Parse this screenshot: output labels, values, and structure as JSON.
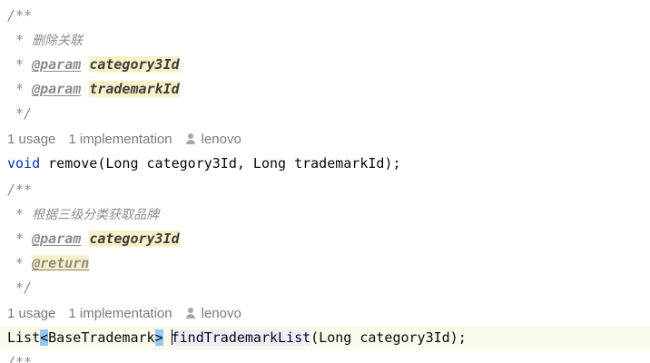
{
  "block1": {
    "open": "/**",
    "star": " * ",
    "desc": "删除关联",
    "param_tag": "@param",
    "param1": "category3Id",
    "param2": "trademarkId",
    "close": " */",
    "usages": "1 usage",
    "implementations": "1 implementation",
    "author": "lenovo",
    "signature": {
      "kw_void": "void",
      "rest": " remove(Long category3Id, Long trademarkId);"
    }
  },
  "block2": {
    "open": "/**",
    "star": " * ",
    "desc": "根据三级分类获取品牌",
    "param_tag": "@param",
    "param1": "category3Id",
    "return_tag": "@return",
    "close": " */",
    "usages": "1 usage",
    "implementations": "1 implementation",
    "author": "lenovo",
    "signature": {
      "list": "List",
      "lt": "<",
      "type": "BaseTrademark",
      "gt": ">",
      "space": " ",
      "method_first": "f",
      "method_rest": "indTrademarkList",
      "args": "(Long category3Id);"
    }
  },
  "next_line_fragment": "/**",
  "icons": {
    "author": "user-icon"
  },
  "colors": {
    "keyword": "#0033b3",
    "comment": "#8c8c8c",
    "param_highlight": "#faf0c8",
    "bracket_highlight": "#93c7f7",
    "current_line": "#fcfaed",
    "hint_text": "#7a7a7a"
  }
}
